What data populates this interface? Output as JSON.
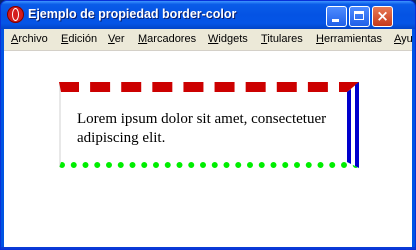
{
  "window": {
    "title": "Ejemplo de propiedad border-color"
  },
  "menu": [
    {
      "first": "A",
      "rest": "rchivo"
    },
    {
      "first": "E",
      "rest": "dición"
    },
    {
      "first": "V",
      "rest": "er"
    },
    {
      "first": "M",
      "rest": "arcadores"
    },
    {
      "first": "W",
      "rest": "idgets"
    },
    {
      "first": "T",
      "rest": "itulares"
    },
    {
      "first": "H",
      "rest": "erramientas"
    },
    {
      "first": "A",
      "rest": "yu"
    }
  ],
  "content": {
    "paragraph": "Lorem ipsum dolor sit amet, consectetuer adipiscing elit."
  },
  "colors": {
    "border_top": "#cc0000",
    "border_right": "#0000cc",
    "border_bottom": "#00ee00",
    "border_left": "#e8e8e8"
  }
}
